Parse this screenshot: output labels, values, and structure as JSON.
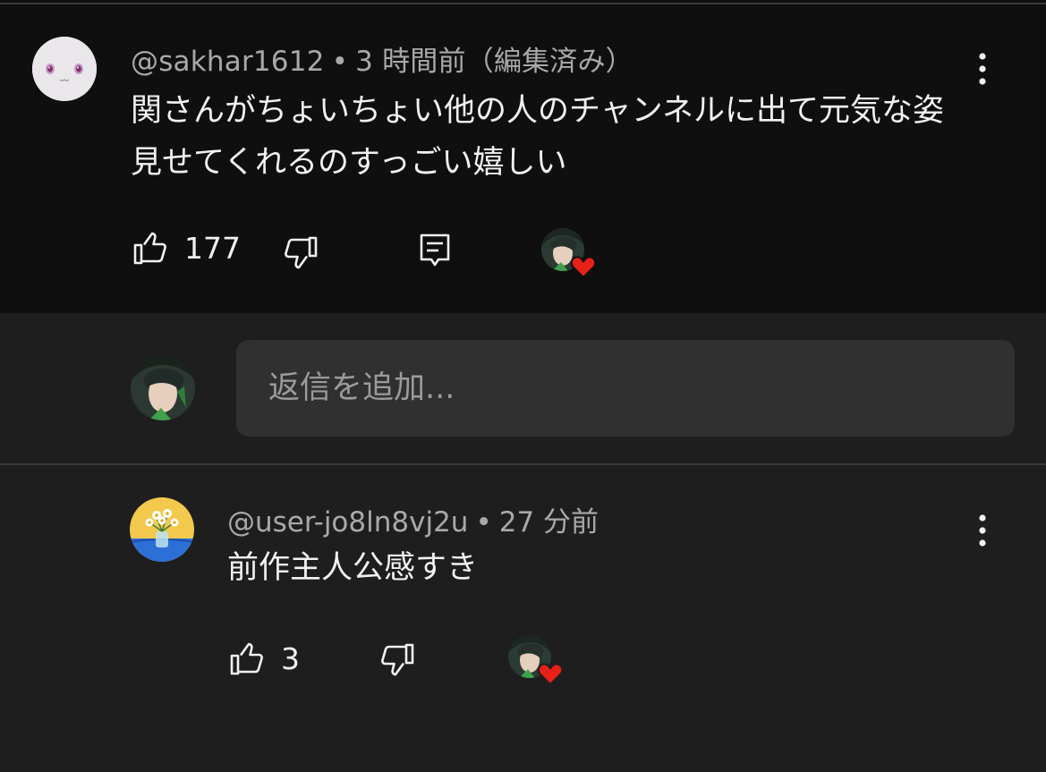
{
  "comment": {
    "author": "@sakhar1612",
    "separator": "•",
    "time": "3 時間前（編集済み）",
    "text": "関さんがちょいちょい他の人のチャンネルに出て元気な姿見せてくれるのすっごい嬉しい",
    "likes": "177",
    "icons": [
      "thumbs-up-icon",
      "thumbs-down-icon",
      "reply-icon",
      "creator-heart-icon",
      "more-vert-icon"
    ]
  },
  "reply_box": {
    "placeholder": "返信を追加..."
  },
  "reply": {
    "author": "@user-jo8ln8vj2u",
    "separator": "•",
    "time": "27 分前",
    "text": "前作主人公感すき",
    "likes": "3",
    "icons": [
      "thumbs-up-icon",
      "thumbs-down-icon",
      "creator-heart-icon",
      "more-vert-icon"
    ]
  },
  "colors": {
    "background": "#0f0f0f",
    "reply_background": "#1e1e1e",
    "input_background": "#303030",
    "text_primary": "#f1f1f1",
    "text_secondary": "#a9a9a9",
    "heart": "#e62117"
  }
}
